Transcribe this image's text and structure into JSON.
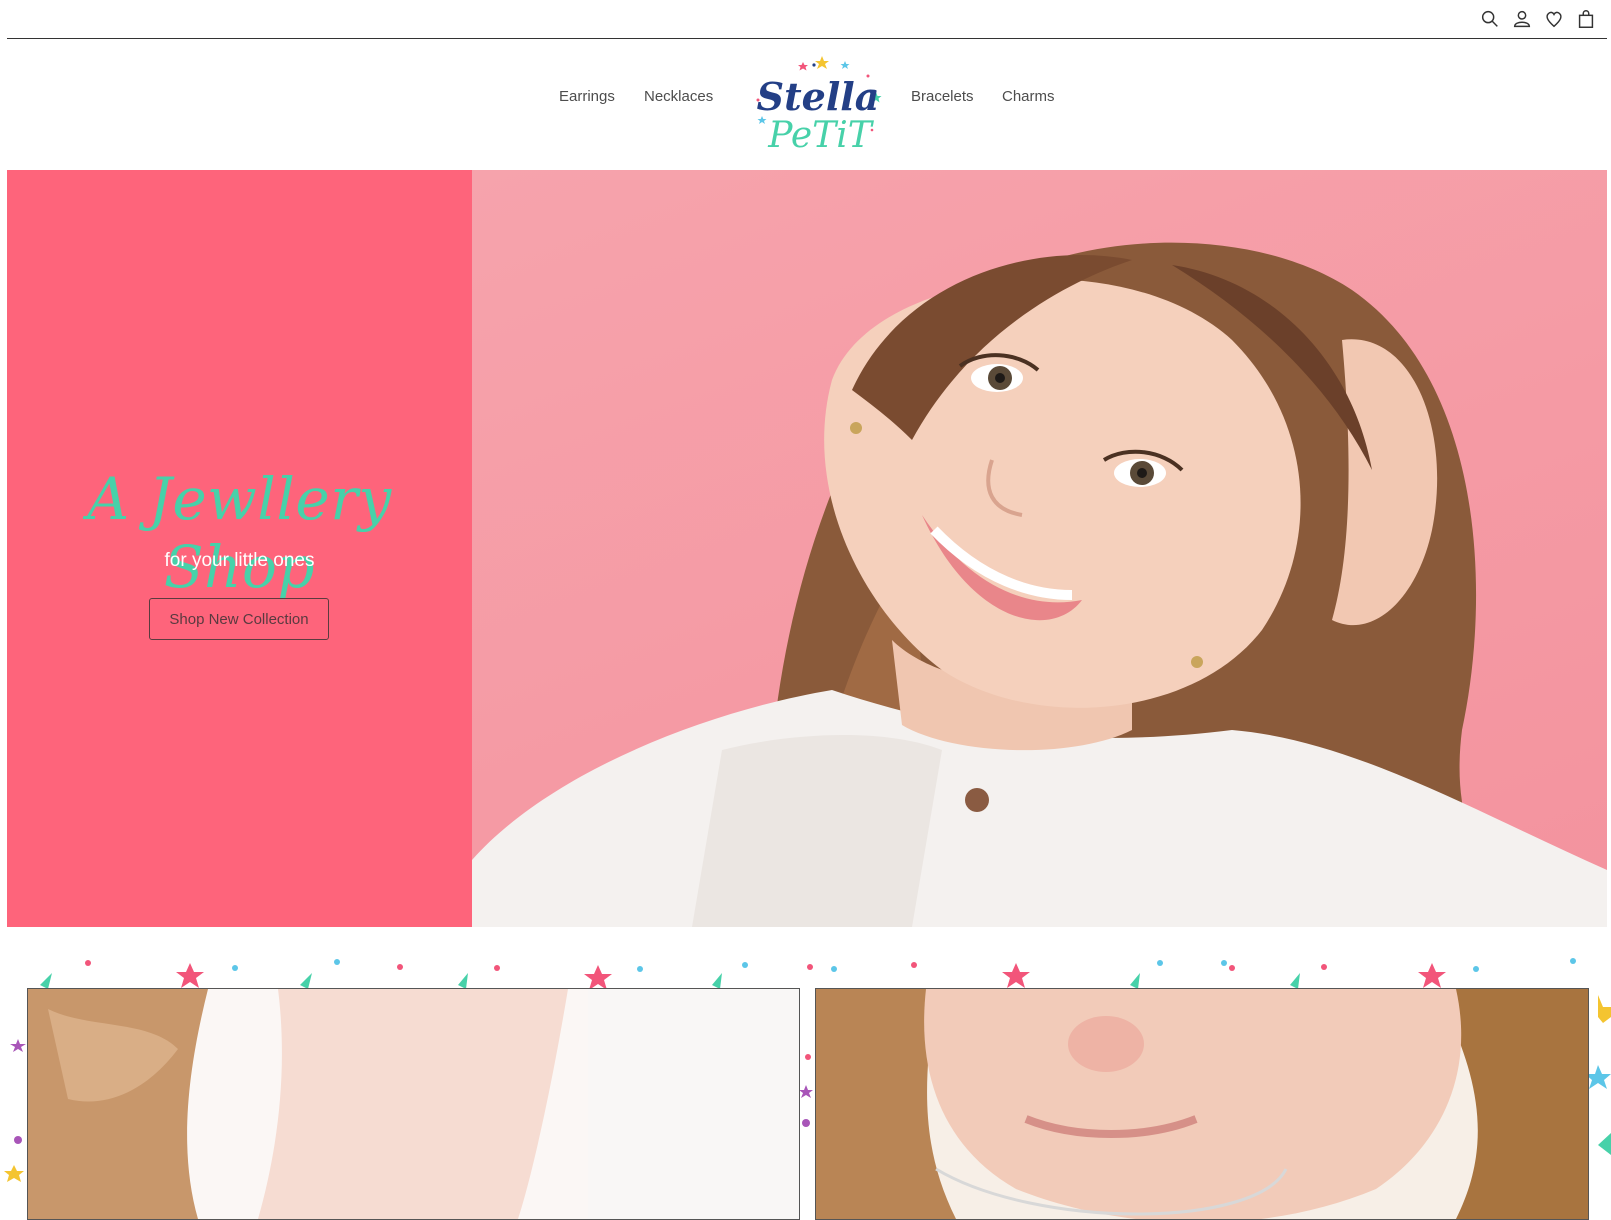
{
  "top_icons": [
    "search-icon",
    "user-icon",
    "heart-icon",
    "bag-icon"
  ],
  "nav": {
    "left": [
      "Earrings",
      "Necklaces"
    ],
    "right": [
      "Bracelets",
      "Charms"
    ]
  },
  "logo": {
    "line1": "Stella",
    "line2": "PeTiT"
  },
  "hero": {
    "headline": "A Jewllery Shop",
    "subheadline": "for your little ones",
    "button": "Shop New Collection"
  },
  "colors": {
    "hero_panel": "#fe647b",
    "headline": "#47d1a9",
    "logo_navy": "#233f86",
    "logo_teal": "#47d1a9"
  }
}
